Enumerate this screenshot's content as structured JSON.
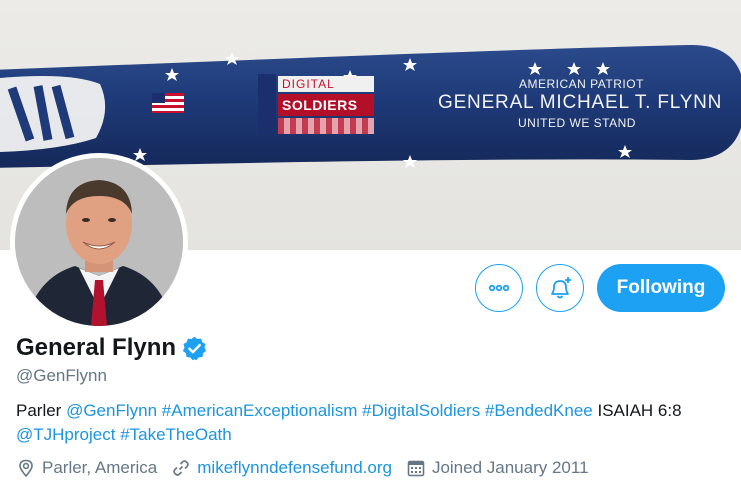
{
  "banner": {
    "bat_line1": "AMERICAN PATRIOT",
    "bat_line2": "GENERAL MICHAEL T. FLYNN",
    "bat_line3": "UNITED WE STAND",
    "logo_top": "DIGITAL",
    "logo_mid": "SOLDIERS"
  },
  "actions": {
    "more_icon": "more-dots-icon",
    "notify_icon": "bell-plus-icon",
    "follow_label": "Following"
  },
  "profile": {
    "display_name": "General Flynn",
    "verified_icon": "verified-badge-icon",
    "handle": "@GenFlynn",
    "bio": {
      "prefix": "Parler ",
      "mention1": "@GenFlynn",
      "tag1": "#AmericanExceptionalism",
      "tag2": "#DigitalSoldiers",
      "tag3": "#BendedKnee",
      "mid": " ISAIAH 6:8 ",
      "mention2": "@TJHproject",
      "tag4": "#TakeTheOath"
    },
    "location": "Parler, America",
    "website": "mikeflynndefensefund.org",
    "joined": "Joined January 2011"
  },
  "colors": {
    "accent": "#1da1f2",
    "link": "#1b95e0",
    "muted": "#657786",
    "bat": "#1e3a78"
  }
}
